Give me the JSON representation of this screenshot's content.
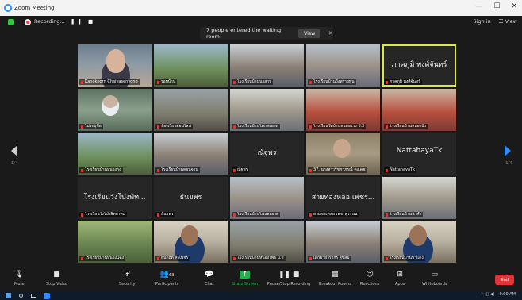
{
  "window": {
    "title": "Zoom Meeting",
    "controls": [
      "—",
      "☐",
      "✕"
    ]
  },
  "top_bar": {
    "recording_label": "Recording...",
    "recording_controls": "❚❚ ■",
    "signin": "Sign in",
    "view": "☷ View"
  },
  "waiting_room": {
    "message": "7 people entered the waiting room",
    "view_label": "View",
    "close_glyph": "✕"
  },
  "pagination": {
    "prev_page": "1/4",
    "next_page": "1/4"
  },
  "participants": [
    {
      "name": "Kanokporn Chaiyasenyong",
      "big": "",
      "scene": "s-face",
      "active": false
    },
    {
      "name": "รอบบ้าน",
      "big": "",
      "scene": "s-outdoor",
      "active": false
    },
    {
      "name": "โรงเรียนบ้านนาสาร",
      "big": "",
      "scene": "s-class1",
      "active": false
    },
    {
      "name": "โรงเรียนบ้านวังทรายพูน",
      "big": "",
      "scene": "s-class2",
      "active": false
    },
    {
      "name": "ภาคภูมิ พงศ์จันทร์",
      "big": "ภาคภูมิ พงศ์จันทร์",
      "scene": "",
      "active": true
    },
    {
      "name": "ไม่ระบุชื่อ",
      "big": "",
      "scene": "s-mask",
      "active": false
    },
    {
      "name": "ห้องเรียนออนไลน์",
      "big": "",
      "scene": "s-room",
      "active": false
    },
    {
      "name": "โรงเรียนบ้านโคกสะอาด",
      "big": "",
      "scene": "s-class3",
      "active": false
    },
    {
      "name": "โรงเรียนวัดบ้านหนองแวง ป.3",
      "big": "",
      "scene": "s-class4",
      "active": false
    },
    {
      "name": "โรงเรียนบ้านหนองบัว",
      "big": "",
      "scene": "s-class4",
      "active": false
    },
    {
      "name": "โรงเรียนบ้านหนองกุง",
      "big": "",
      "scene": "s-outdoor",
      "active": false
    },
    {
      "name": "โรงเรียนบ้านดอนจาน",
      "big": "",
      "scene": "s-class1",
      "active": false
    },
    {
      "name": "ณัฐพร",
      "big": "ณัฐพร",
      "scene": "",
      "active": false
    },
    {
      "name": "37. นางสาวรัชฎาภรณ์ คงเดช",
      "big": "",
      "scene": "s-old",
      "active": false
    },
    {
      "name": "NattahayaTk",
      "big": "NattahayaTk",
      "scene": "",
      "active": false
    },
    {
      "name": "โรงเรียนวังโป่งพิทยาคม",
      "big": "โรงเรียนวังโป่งพิท...",
      "scene": "",
      "active": false
    },
    {
      "name": "ธันยพร",
      "big": "ธันยพร",
      "scene": "",
      "active": false
    },
    {
      "name": "โรงเรียนบ้านโนนสะอาด",
      "big": "",
      "scene": "s-class2",
      "active": false
    },
    {
      "name": "สายทองหล่อ เพชรสุวรรณ",
      "big": "สายทองหล่อ เพชร...",
      "scene": "",
      "active": false
    },
    {
      "name": "โรงเรียนบ้านนาคำ",
      "big": "",
      "scene": "s-class3",
      "active": false
    },
    {
      "name": "โรงเรียนบ้านหนองแดง",
      "big": "",
      "scene": "s-green",
      "active": false
    },
    {
      "name": "ธนกฤต ศรีเพชร",
      "big": "",
      "scene": "s-man",
      "active": false
    },
    {
      "name": "โรงเรียนบ้านหนองโพธิ์ ม.2",
      "big": "",
      "scene": "s-room",
      "active": false
    },
    {
      "name": "เด็กชายวรากร สุขสม",
      "big": "",
      "scene": "s-class1",
      "active": false
    },
    {
      "name": "โรงเรียนบ้านป่าแดง",
      "big": "",
      "scene": "s-man",
      "active": false
    }
  ],
  "toolbar": {
    "mute": "Mute",
    "stop_video": "Stop Video",
    "security": "Security",
    "participants": "Participants",
    "participants_count": "63",
    "chat": "Chat",
    "share_screen": "Share Screen",
    "pause_recording": "Pause/Stop Recording",
    "breakout_rooms": "Breakout Rooms",
    "reactions": "Reactions",
    "apps": "Apps",
    "whiteboards": "Whiteboards",
    "end": "End"
  },
  "taskbar": {
    "time": "9:00 AM"
  }
}
